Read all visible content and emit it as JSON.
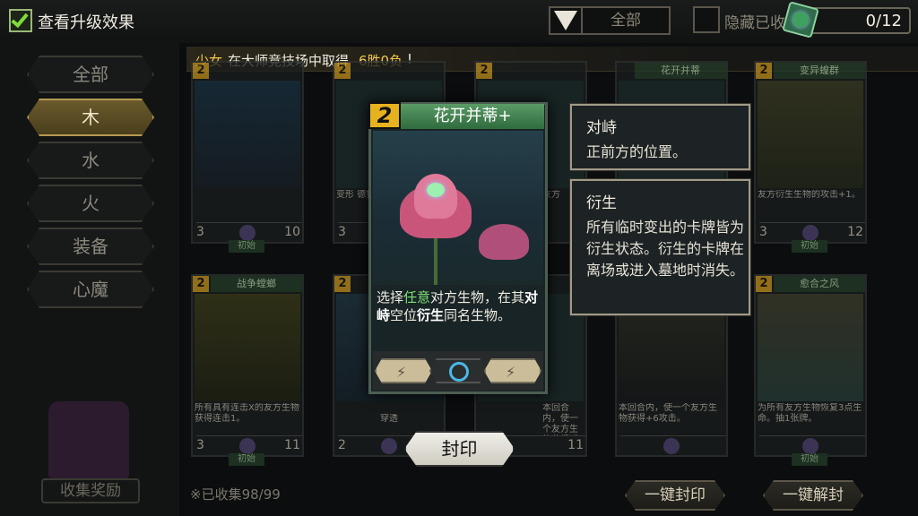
{
  "header": {
    "upgrade_label": "查看升级效果",
    "filter_value": "全部",
    "hide_label": "隐藏已收",
    "count": "0/12"
  },
  "sidebar": {
    "items": [
      {
        "label": "全部"
      },
      {
        "label": "木"
      },
      {
        "label": "水"
      },
      {
        "label": "火"
      },
      {
        "label": "装备"
      },
      {
        "label": "心魔"
      }
    ],
    "selected": "木",
    "chest_label": "收集奖励"
  },
  "banner": {
    "name": "少女",
    "mid": "在大师竞技场中取得",
    "result": "6胜0负",
    "end": "!"
  },
  "cards": [
    {
      "cost": "2",
      "name": "",
      "text": "",
      "atk": "3",
      "hp": "10",
      "badge": "初始"
    },
    {
      "cost": "2",
      "name": "",
      "text": "变形 德鲁伊 1。",
      "atk": "3",
      "hp": "",
      "badge": ""
    },
    {
      "cost": "2",
      "name": "",
      "text": "友方",
      "atk": "",
      "hp": "",
      "badge": ""
    },
    {
      "cost": "",
      "name": "花开并蒂",
      "text": "",
      "atk": "",
      "hp": "",
      "badge": ""
    },
    {
      "cost": "2",
      "name": "变异蝗群",
      "text": "友方衍生生物的攻击+1。",
      "atk": "3",
      "hp": "12",
      "badge": "初始"
    },
    {
      "cost": "2",
      "name": "战争螳螂",
      "text": "所有具有连击X的友方生物获得连击1。",
      "atk": "3",
      "hp": "11",
      "badge": "初始"
    },
    {
      "cost": "2",
      "name": "",
      "text": "穿透",
      "atk": "2",
      "hp": "",
      "badge": ""
    },
    {
      "cost": "",
      "name": "",
      "text": "本回合内，使一个友方生物获得透骨。",
      "atk": "",
      "hp": "11",
      "badge": ""
    },
    {
      "cost": "",
      "name": "",
      "text": "本回合内，使一个友方生物获得+6攻击。",
      "atk": "",
      "hp": "",
      "badge": ""
    },
    {
      "cost": "2",
      "name": "愈合之风",
      "text": "为所有友方生物恢复3点生命。抽1张牌。",
      "atk": "",
      "hp": "",
      "badge": "初始"
    }
  ],
  "detail": {
    "cost": "2",
    "name": "花开并蒂+",
    "text_1": "选择",
    "text_2": "任意",
    "text_3": "对方生物，在其",
    "text_4": "对峙",
    "text_5": "空位",
    "text_6": "衍生",
    "text_7": "同名生物。"
  },
  "tooltips": [
    {
      "title": "对峙",
      "body": "正前方的位置。"
    },
    {
      "title": "衍生",
      "body": "所有临时变出的卡牌皆为衍生状态。衍生的卡牌在离场或进入墓地时消失。"
    }
  ],
  "seal_label": "封印",
  "collected": "※已收集98/99",
  "bottom_buttons": {
    "seal_all": "一键封印",
    "unseal_all": "一键解封"
  },
  "colors": {
    "accent_gold": "#e6b21e",
    "green_keyword": "#7fe07a",
    "card_title_green": "#2f6b3e"
  }
}
